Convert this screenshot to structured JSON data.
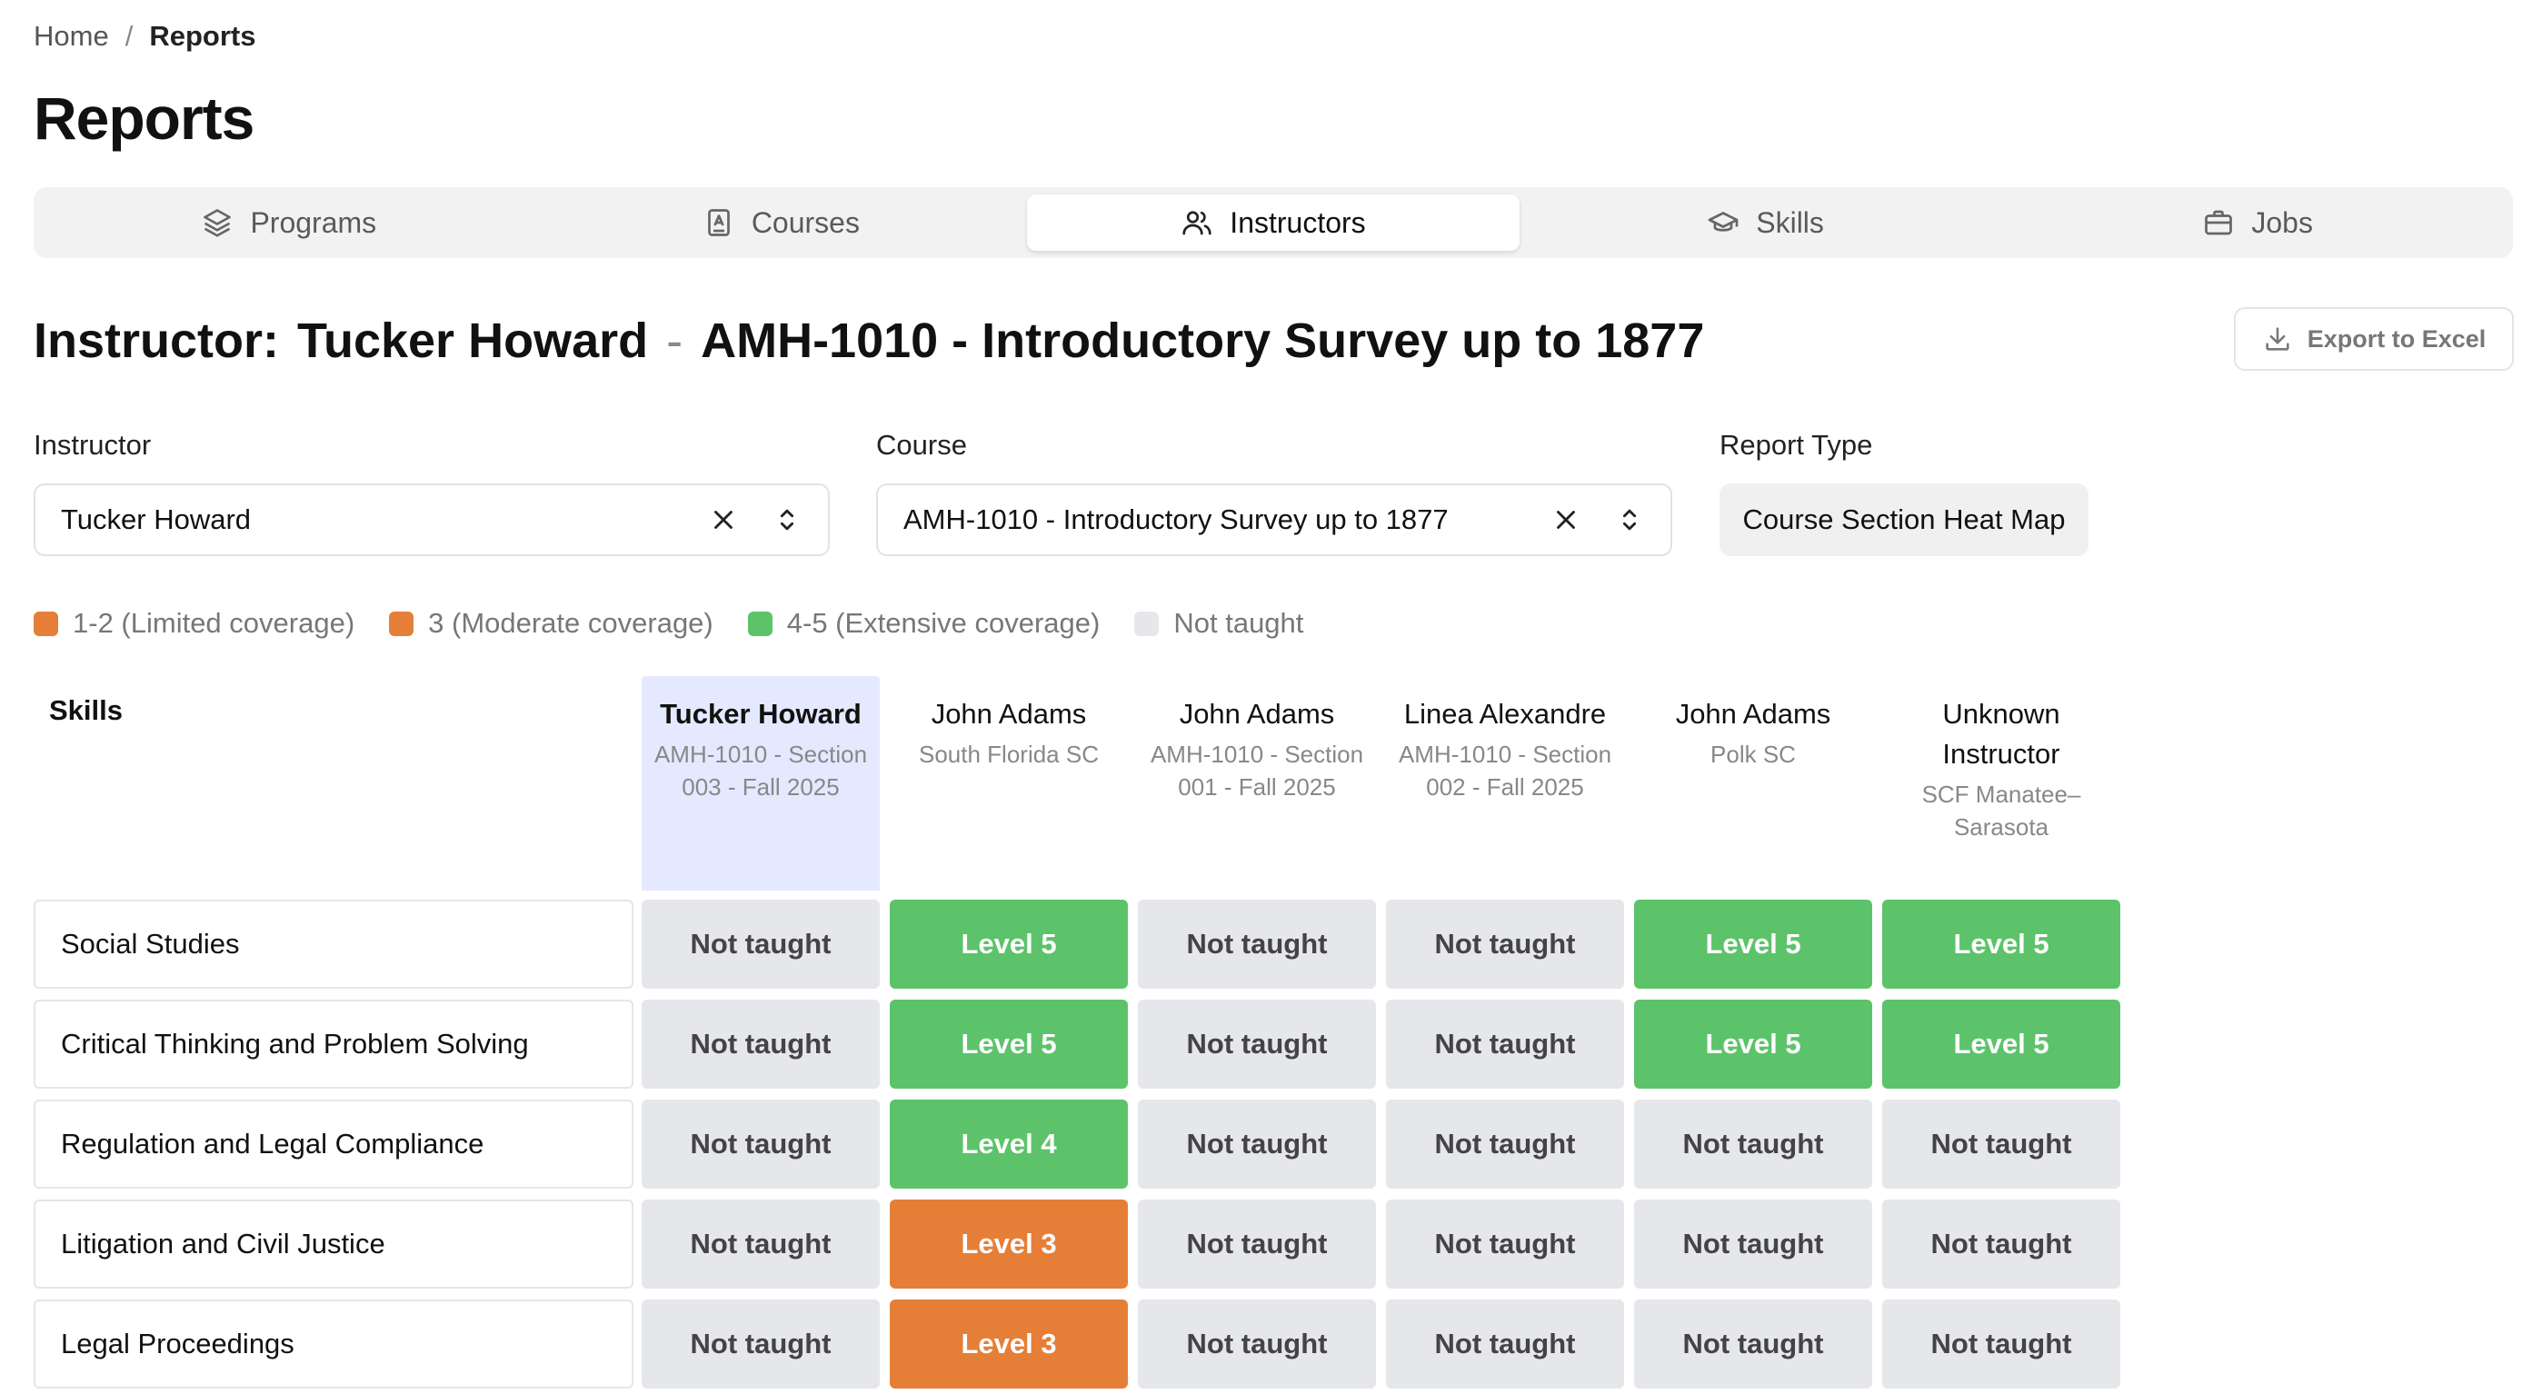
{
  "breadcrumb": {
    "home": "Home",
    "separator": "/",
    "current": "Reports"
  },
  "page_title": "Reports",
  "tabs": [
    {
      "label": "Programs",
      "icon": "layers-icon"
    },
    {
      "label": "Courses",
      "icon": "book-icon"
    },
    {
      "label": "Instructors",
      "icon": "users-icon",
      "active": true
    },
    {
      "label": "Skills",
      "icon": "graduation-cap-icon"
    },
    {
      "label": "Jobs",
      "icon": "briefcase-icon"
    }
  ],
  "heading": {
    "prefix": "Instructor:",
    "instructor": "Tucker Howard",
    "dash": "-",
    "course": "AMH-1010 - Introductory Survey up to 1877"
  },
  "export_label": "Export to Excel",
  "filters": {
    "instructor_label": "Instructor",
    "instructor_value": "Tucker Howard",
    "course_label": "Course",
    "course_value": "AMH-1010 - Introductory Survey up to 1877",
    "report_type_label": "Report Type",
    "report_type_value": "Course Section Heat Map"
  },
  "legend": [
    {
      "label": "1-2 (Limited coverage)",
      "color": "#e57f37"
    },
    {
      "label": "3 (Moderate coverage)",
      "color": "#e57f37"
    },
    {
      "label": "4-5 (Extensive coverage)",
      "color": "#5cc36a"
    },
    {
      "label": "Not taught",
      "color": "#e6e7eb"
    }
  ],
  "grid": {
    "skills_header": "Skills",
    "columns": [
      {
        "name": "Tucker Howard",
        "sub": "AMH-1010 - Section 003 - Fall 2025",
        "highlight": true
      },
      {
        "name": "John Adams",
        "sub": "South Florida SC"
      },
      {
        "name": "John Adams",
        "sub": "AMH-1010 - Section 001 - Fall 2025"
      },
      {
        "name": "Linea Alexandre",
        "sub": "AMH-1010 - Section 002 - Fall 2025"
      },
      {
        "name": "John Adams",
        "sub": "Polk SC"
      },
      {
        "name": "Unknown Instructor",
        "sub": "SCF Manatee–Sarasota"
      }
    ],
    "rows": [
      {
        "skill": "Social Studies",
        "cells": [
          {
            "text": "Not taught",
            "level": 0
          },
          {
            "text": "Level 5",
            "level": 5
          },
          {
            "text": "Not taught",
            "level": 0
          },
          {
            "text": "Not taught",
            "level": 0
          },
          {
            "text": "Level 5",
            "level": 5
          },
          {
            "text": "Level 5",
            "level": 5
          }
        ]
      },
      {
        "skill": "Critical Thinking and Problem Solving",
        "cells": [
          {
            "text": "Not taught",
            "level": 0
          },
          {
            "text": "Level 5",
            "level": 5
          },
          {
            "text": "Not taught",
            "level": 0
          },
          {
            "text": "Not taught",
            "level": 0
          },
          {
            "text": "Level 5",
            "level": 5
          },
          {
            "text": "Level 5",
            "level": 5
          }
        ]
      },
      {
        "skill": "Regulation and Legal Compliance",
        "cells": [
          {
            "text": "Not taught",
            "level": 0
          },
          {
            "text": "Level 4",
            "level": 4
          },
          {
            "text": "Not taught",
            "level": 0
          },
          {
            "text": "Not taught",
            "level": 0
          },
          {
            "text": "Not taught",
            "level": 0
          },
          {
            "text": "Not taught",
            "level": 0
          }
        ]
      },
      {
        "skill": "Litigation and Civil Justice",
        "cells": [
          {
            "text": "Not taught",
            "level": 0
          },
          {
            "text": "Level 3",
            "level": 3
          },
          {
            "text": "Not taught",
            "level": 0
          },
          {
            "text": "Not taught",
            "level": 0
          },
          {
            "text": "Not taught",
            "level": 0
          },
          {
            "text": "Not taught",
            "level": 0
          }
        ]
      },
      {
        "skill": "Legal Proceedings",
        "cells": [
          {
            "text": "Not taught",
            "level": 0
          },
          {
            "text": "Level 3",
            "level": 3
          },
          {
            "text": "Not taught",
            "level": 0
          },
          {
            "text": "Not taught",
            "level": 0
          },
          {
            "text": "Not taught",
            "level": 0
          },
          {
            "text": "Not taught",
            "level": 0
          }
        ]
      }
    ]
  }
}
